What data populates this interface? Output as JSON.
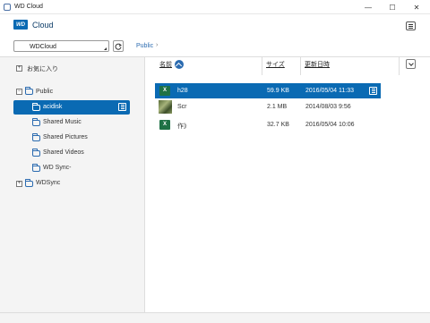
{
  "window": {
    "title": "WD Cloud",
    "minimize": "—",
    "maximize": "☐",
    "close": "✕"
  },
  "app": {
    "logo_text": "WD",
    "app_name": "Cloud"
  },
  "location": {
    "device": "WDCloud",
    "breadcrumb": "Public",
    "breadcrumb_sep": "›"
  },
  "sidebar": {
    "favorites_label": "お気に入り",
    "items": [
      {
        "label": "Public",
        "expander": "−"
      },
      {
        "label": "acidisk"
      },
      {
        "label": "Shared Music"
      },
      {
        "label": "Shared Pictures"
      },
      {
        "label": "Shared Videos"
      },
      {
        "label": "WD Sync-"
      },
      {
        "label": "WDSync",
        "expander": "+"
      }
    ]
  },
  "table": {
    "columns": {
      "name": "名前",
      "size": "サイズ",
      "date": "更新日時"
    },
    "rows": [
      {
        "name": "h28",
        "size": "59.9 KB",
        "date": "2016/05/04 11:33",
        "icon": "excel-icon",
        "selected": true
      },
      {
        "name": "Scr",
        "size": "2.1 MB",
        "date": "2014/08/03 9:56",
        "icon": "image-thumbnail",
        "selected": false
      },
      {
        "name": "作》",
        "size": "32.7 KB",
        "date": "2016/05/04 10:06",
        "icon": "excel-icon",
        "selected": false
      }
    ]
  },
  "icons": {
    "excel_glyph": "X"
  },
  "colors": {
    "accent": "#0a6ab3",
    "excel": "#1e7145"
  }
}
